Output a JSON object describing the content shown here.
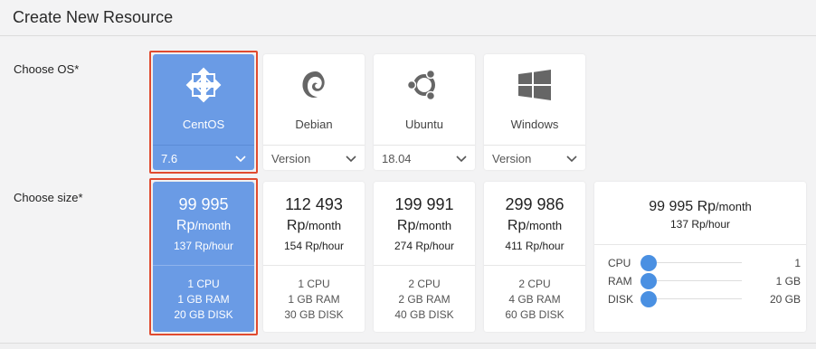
{
  "header": {
    "title": "Create New Resource"
  },
  "labels": {
    "choose_os": "Choose OS*",
    "choose_size": "Choose size*"
  },
  "os_options": [
    {
      "name": "CentOS",
      "icon": "centos-icon",
      "version": "7.6",
      "selected": true
    },
    {
      "name": "Debian",
      "icon": "debian-icon",
      "version": "Version",
      "selected": false
    },
    {
      "name": "Ubuntu",
      "icon": "ubuntu-icon",
      "version": "18.04",
      "selected": false
    },
    {
      "name": "Windows",
      "icon": "windows-icon",
      "version": "Version",
      "selected": false
    }
  ],
  "sizes": [
    {
      "price_top": "99 995",
      "price_currency": "Rp",
      "price_unit": "/month",
      "hourly": "137 Rp/hour",
      "cpu": "1 CPU",
      "ram": "1 GB RAM",
      "disk": "20 GB DISK",
      "selected": true
    },
    {
      "price_top": "112 493",
      "price_currency": "Rp",
      "price_unit": "/month",
      "hourly": "154 Rp/hour",
      "cpu": "1 CPU",
      "ram": "1 GB RAM",
      "disk": "30 GB DISK",
      "selected": false
    },
    {
      "price_top": "199 991",
      "price_currency": "Rp",
      "price_unit": "/month",
      "hourly": "274 Rp/hour",
      "cpu": "2 CPU",
      "ram": "2 GB RAM",
      "disk": "40 GB DISK",
      "selected": false
    },
    {
      "price_top": "299 986",
      "price_currency": "Rp",
      "price_unit": "/month",
      "hourly": "411 Rp/hour",
      "cpu": "2 CPU",
      "ram": "4 GB RAM",
      "disk": "60 GB DISK",
      "selected": false
    }
  ],
  "custom": {
    "price": "99 995 Rp",
    "price_unit": "/month",
    "hourly": "137 Rp/hour",
    "sliders": [
      {
        "label": "CPU",
        "value": "1"
      },
      {
        "label": "RAM",
        "value": "1 GB"
      },
      {
        "label": "DISK",
        "value": "20 GB"
      }
    ]
  },
  "colors": {
    "selected_bg": "#6a9be5",
    "outline": "#e04a2f",
    "slider_knob": "#4a90e2"
  }
}
